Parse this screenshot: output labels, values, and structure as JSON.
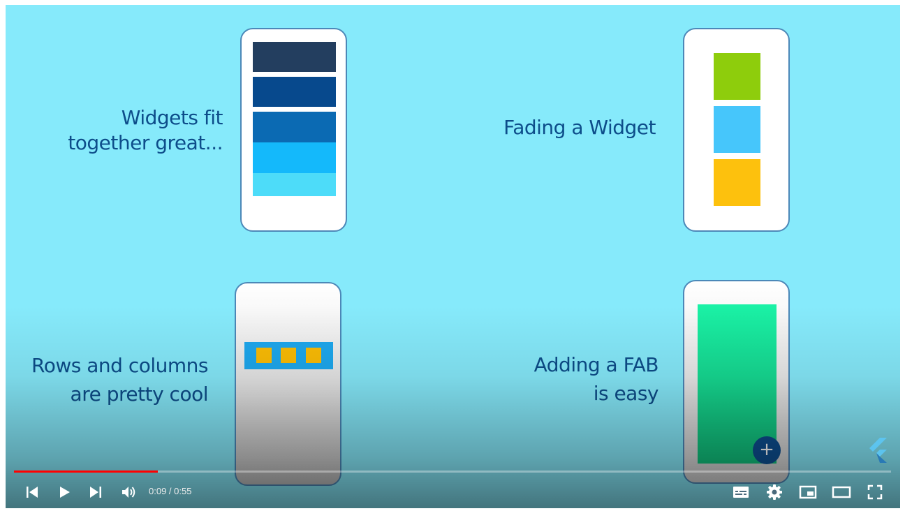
{
  "slides": {
    "widgets": {
      "line1": "Widgets fit",
      "line2": "together great..."
    },
    "fading": {
      "line1": "Fading a Widget"
    },
    "rows": {
      "line1": "Rows and columns",
      "line2": "are pretty cool"
    },
    "fab": {
      "line1": "Adding a FAB",
      "line2": "is easy",
      "button_glyph": "+"
    }
  },
  "stack_colors": [
    "#233e5f",
    "#07498d",
    "#0b6ab3",
    "#14b9fb",
    "#4ddcf9"
  ],
  "fade_colors": [
    "#8ecd0c",
    "#46c6fb",
    "#fdc10d"
  ],
  "player": {
    "current_time": "0:09",
    "duration": "0:55",
    "time_display": "0:09 / 0:55",
    "progress": 0.164,
    "accent_color": "#ff0000",
    "icons": [
      "previous-icon",
      "play-icon",
      "next-icon",
      "volume-icon",
      "subtitles-icon",
      "settings-icon",
      "miniplayer-icon",
      "theater-mode-icon",
      "fullscreen-icon"
    ]
  }
}
